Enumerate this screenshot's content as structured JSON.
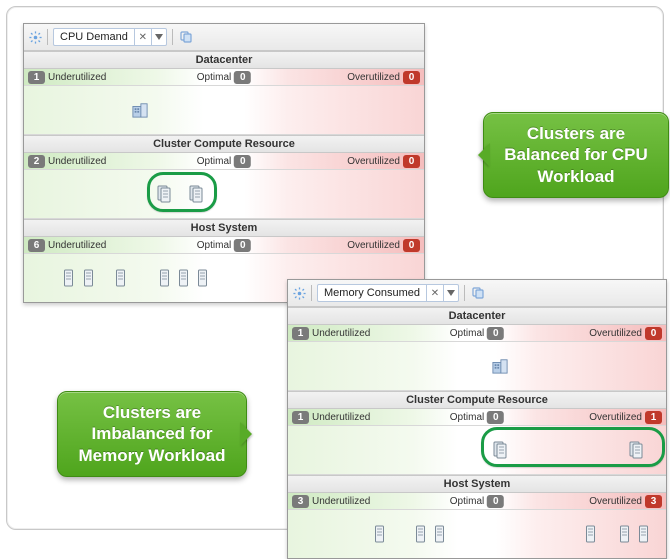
{
  "labels": {
    "under": "Underutilized",
    "optimal": "Optimal",
    "over": "Overutilized"
  },
  "panel1": {
    "metric": "CPU Demand",
    "sections": [
      {
        "title": "Datacenter",
        "under_count": "1",
        "optimal_count": "0",
        "over_count": "0",
        "over_style": "red"
      },
      {
        "title": "Cluster Compute Resource",
        "under_count": "2",
        "optimal_count": "0",
        "over_count": "0",
        "over_style": "red"
      },
      {
        "title": "Host System",
        "under_count": "6",
        "optimal_count": "0",
        "over_count": "0",
        "over_style": "red"
      }
    ]
  },
  "panel2": {
    "metric": "Memory Consumed",
    "sections": [
      {
        "title": "Datacenter",
        "under_count": "1",
        "optimal_count": "0",
        "over_count": "0",
        "over_style": "red"
      },
      {
        "title": "Cluster Compute Resource",
        "under_count": "1",
        "optimal_count": "0",
        "over_count": "1",
        "over_style": "red"
      },
      {
        "title": "Host System",
        "under_count": "3",
        "optimal_count": "0",
        "over_count": "3",
        "over_style": "red"
      }
    ]
  },
  "callouts": {
    "c1": "Clusters are Balanced for CPU Workload",
    "c2": "Clusters are Imbalanced for Memory Workload"
  }
}
